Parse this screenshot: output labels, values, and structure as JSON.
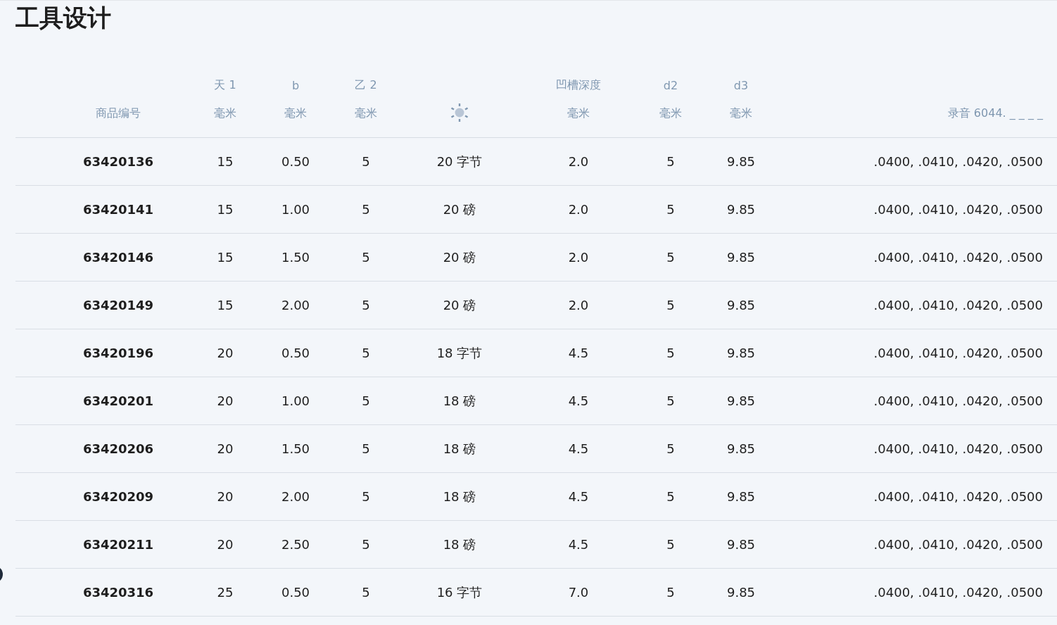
{
  "title": "工具设计",
  "columns": [
    {
      "unit": "商品编号",
      "kind": "text"
    },
    {
      "top": "天 1",
      "unit": "毫米",
      "kind": "text"
    },
    {
      "top": "b",
      "unit": "毫米",
      "kind": "text"
    },
    {
      "top": "乙 2",
      "unit": "毫米",
      "kind": "text"
    },
    {
      "kind": "icon"
    },
    {
      "top": "凹槽深度",
      "unit": "毫米",
      "kind": "text"
    },
    {
      "top": "d2",
      "unit": "毫米",
      "kind": "text"
    },
    {
      "top": "d3",
      "unit": "毫米",
      "kind": "text"
    },
    {
      "unit": "录音 6044. _ _ _ _",
      "kind": "text"
    }
  ],
  "rows": [
    [
      "63420136",
      "15",
      "0.50",
      "5",
      "20 字节",
      "2.0",
      "5",
      "9.85",
      ".0400, .0410, .0420, .0500"
    ],
    [
      "63420141",
      "15",
      "1.00",
      "5",
      "20 磅",
      "2.0",
      "5",
      "9.85",
      ".0400, .0410, .0420, .0500"
    ],
    [
      "63420146",
      "15",
      "1.50",
      "5",
      "20 磅",
      "2.0",
      "5",
      "9.85",
      ".0400, .0410, .0420, .0500"
    ],
    [
      "63420149",
      "15",
      "2.00",
      "5",
      "20 磅",
      "2.0",
      "5",
      "9.85",
      ".0400, .0410, .0420, .0500"
    ],
    [
      "63420196",
      "20",
      "0.50",
      "5",
      "18 字节",
      "4.5",
      "5",
      "9.85",
      ".0400, .0410, .0420, .0500"
    ],
    [
      "63420201",
      "20",
      "1.00",
      "5",
      "18 磅",
      "4.5",
      "5",
      "9.85",
      ".0400, .0410, .0420, .0500"
    ],
    [
      "63420206",
      "20",
      "1.50",
      "5",
      "18 磅",
      "4.5",
      "5",
      "9.85",
      ".0400, .0410, .0420, .0500"
    ],
    [
      "63420209",
      "20",
      "2.00",
      "5",
      "18 磅",
      "4.5",
      "5",
      "9.85",
      ".0400, .0410, .0420, .0500"
    ],
    [
      "63420211",
      "20",
      "2.50",
      "5",
      "18 磅",
      "4.5",
      "5",
      "9.85",
      ".0400, .0410, .0420, .0500"
    ],
    [
      "63420316",
      "25",
      "0.50",
      "5",
      "16 字节",
      "7.0",
      "5",
      "9.85",
      ".0400, .0410, .0420, .0500"
    ]
  ]
}
